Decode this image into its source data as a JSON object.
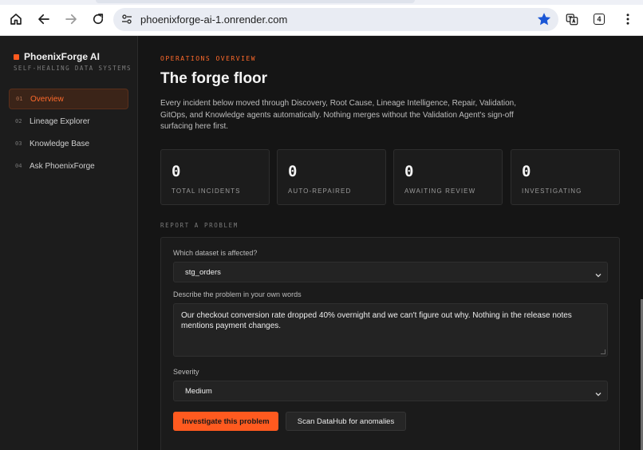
{
  "browser": {
    "url": "phoenixforge-ai-1.onrender.com",
    "tab_count": "4",
    "icons": [
      "home-icon",
      "back-icon",
      "forward-icon",
      "reload-icon",
      "site-settings-icon",
      "bookmark-star-icon",
      "translate-icon",
      "tab-switcher-icon",
      "more-menu-icon"
    ],
    "star_color": "#1a56d6"
  },
  "sidebar": {
    "brand": "PhoenixForge AI",
    "tagline": "SELF-HEALING DATA SYSTEMS",
    "items": [
      {
        "num": "01",
        "label": "Overview",
        "active": true
      },
      {
        "num": "02",
        "label": "Lineage Explorer",
        "active": false
      },
      {
        "num": "03",
        "label": "Knowledge Base",
        "active": false
      },
      {
        "num": "04",
        "label": "Ask PhoenixForge",
        "active": false
      }
    ]
  },
  "main": {
    "eyebrow": "OPERATIONS OVERVIEW",
    "title": "The forge floor",
    "intro": "Every incident below moved through Discovery, Root Cause, Lineage Intelligence, Repair, Validation, GitOps, and Knowledge agents automatically. Nothing merges without the Validation Agent's sign-off surfacing here first.",
    "stats": [
      {
        "value": "0",
        "label": "TOTAL INCIDENTS"
      },
      {
        "value": "0",
        "label": "AUTO-REPAIRED"
      },
      {
        "value": "0",
        "label": "AWAITING REVIEW"
      },
      {
        "value": "0",
        "label": "INVESTIGATING"
      }
    ],
    "report": {
      "section_label": "REPORT A PROBLEM",
      "dataset_label": "Which dataset is affected?",
      "dataset_value": "stg_orders",
      "problem_label": "Describe the problem in your own words",
      "problem_value": "Our checkout conversion rate dropped 40% overnight and we can't figure out why. Nothing in the release notes mentions payment changes.",
      "severity_label": "Severity",
      "severity_value": "Medium",
      "primary_button": "Investigate this problem",
      "secondary_button": "Scan DataHub for anomalies"
    }
  },
  "colors": {
    "accent": "#ff5a1f",
    "background": "#151515",
    "sidebar": "#1c1c1c"
  }
}
